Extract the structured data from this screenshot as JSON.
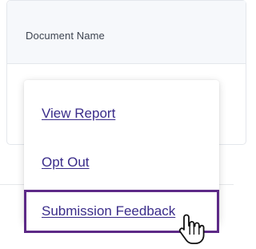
{
  "table": {
    "header": {
      "document_name": "Document Name"
    }
  },
  "menu": {
    "items": [
      {
        "label": "View Report"
      },
      {
        "label": "Opt Out"
      },
      {
        "label": "Submission Feedback"
      }
    ]
  },
  "colors": {
    "link": "#3a2c8a",
    "highlight_border": "#5d2a87",
    "header_bg": "#f6f8fb"
  },
  "icons": {
    "cursor": "hand-pointer-icon"
  }
}
